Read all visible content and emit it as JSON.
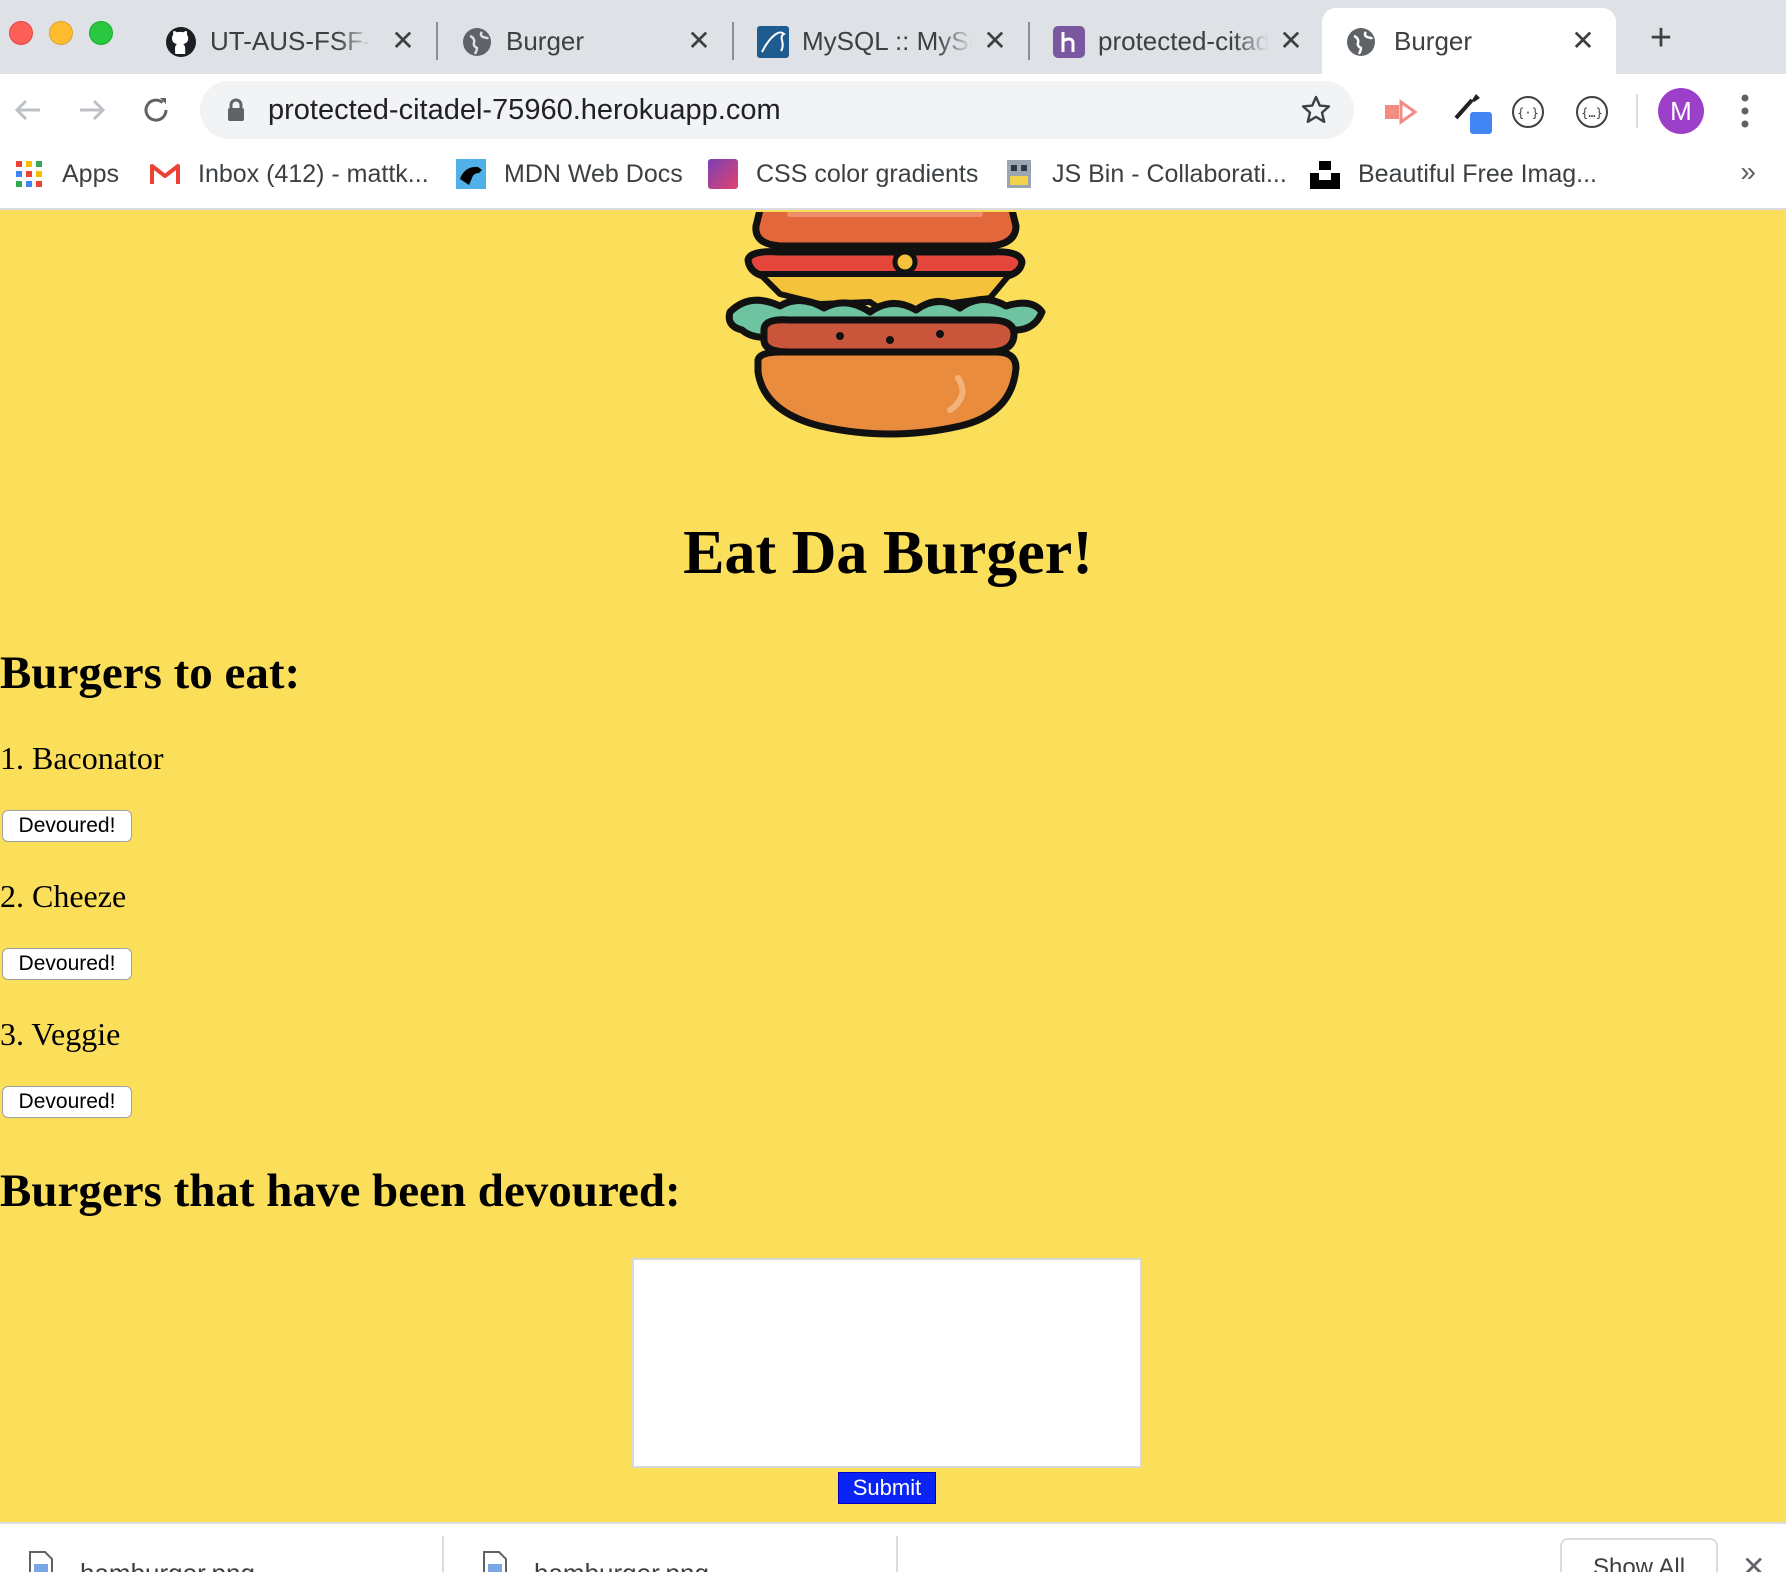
{
  "browser": {
    "tabs": [
      {
        "title": "UT-AUS-FSF-P",
        "icon": "github-icon"
      },
      {
        "title": "Burger",
        "icon": "globe-icon"
      },
      {
        "title": "MySQL :: MySQ",
        "icon": "mysql-icon"
      },
      {
        "title": "protected-citad",
        "icon": "heroku-icon"
      },
      {
        "title": "Burger",
        "icon": "globe-icon",
        "active": true
      }
    ],
    "url": "protected-citadel-75960.herokuapp.com",
    "profile_initial": "M",
    "profile_color": "#9c3fc9",
    "bookmarks": [
      {
        "label": "Apps",
        "icon": "apps-grid-icon"
      },
      {
        "label": "Inbox (412) - mattk...",
        "icon": "gmail-icon"
      },
      {
        "label": "MDN Web Docs",
        "icon": "mdn-icon"
      },
      {
        "label": "CSS color gradients",
        "icon": "gradient-icon"
      },
      {
        "label": "JS Bin - Collaborati...",
        "icon": "jsbin-icon"
      },
      {
        "label": "Beautiful Free Imag...",
        "icon": "unsplash-icon"
      }
    ],
    "bookmarks_more": "»"
  },
  "page": {
    "background": "#fbdf5b",
    "title": "Eat Da Burger!",
    "to_eat_heading": "Burgers to eat:",
    "devoured_heading": "Burgers that have been devoured:",
    "burgers_to_eat": [
      {
        "name": "1. Baconator",
        "button": "Devoured!"
      },
      {
        "name": "2. Cheeze",
        "button": "Devoured!"
      },
      {
        "name": "3. Veggie",
        "button": "Devoured!"
      }
    ],
    "input_value": "",
    "submit_label": "Submit"
  },
  "downloads": {
    "items": [
      {
        "name": "hamburger.png"
      },
      {
        "name": "hamburger.png"
      }
    ],
    "show_all_label": "Show All"
  }
}
